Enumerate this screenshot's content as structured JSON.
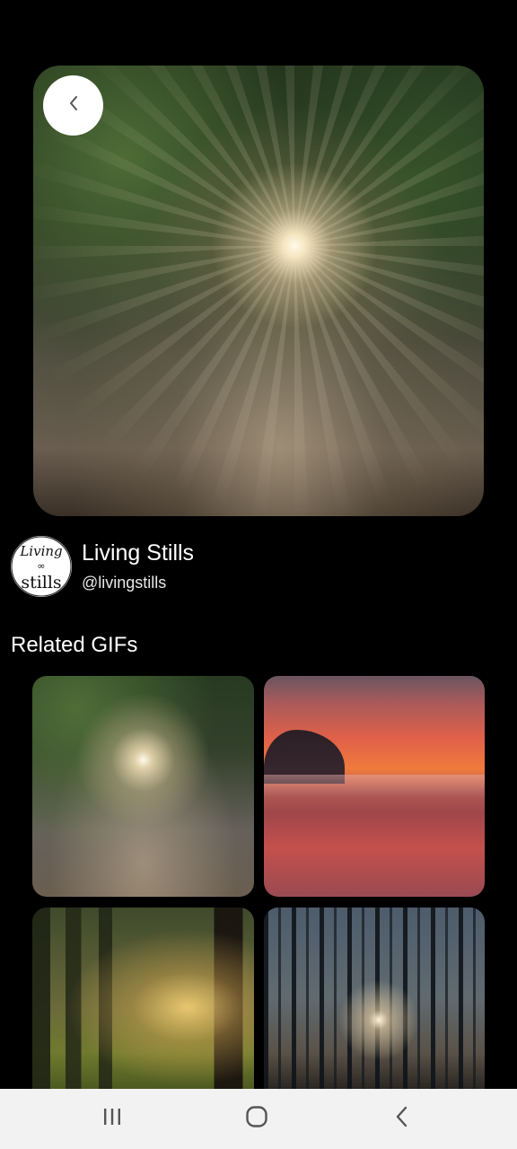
{
  "header": {
    "back_icon": "chevron-left-icon"
  },
  "hero": {
    "gif_subject": "sunlight through forest trees"
  },
  "channel": {
    "name": "Living Stills",
    "handle": "@livingstills",
    "avatar_logo_text": "Living stills"
  },
  "related": {
    "title": "Related GIFs",
    "items": [
      {
        "subject": "sunlight through forest trees"
      },
      {
        "subject": "red sunset over misty lake"
      },
      {
        "subject": "golden sunlight through poplar trees"
      },
      {
        "subject": "sunrise through pine forest"
      }
    ]
  },
  "navbar": {
    "recents_icon": "recents-icon",
    "home_icon": "home-icon",
    "back_icon": "back-icon"
  },
  "colors": {
    "background": "#000000",
    "navbar": "#f2f2f2",
    "text_primary": "#ffffff"
  }
}
